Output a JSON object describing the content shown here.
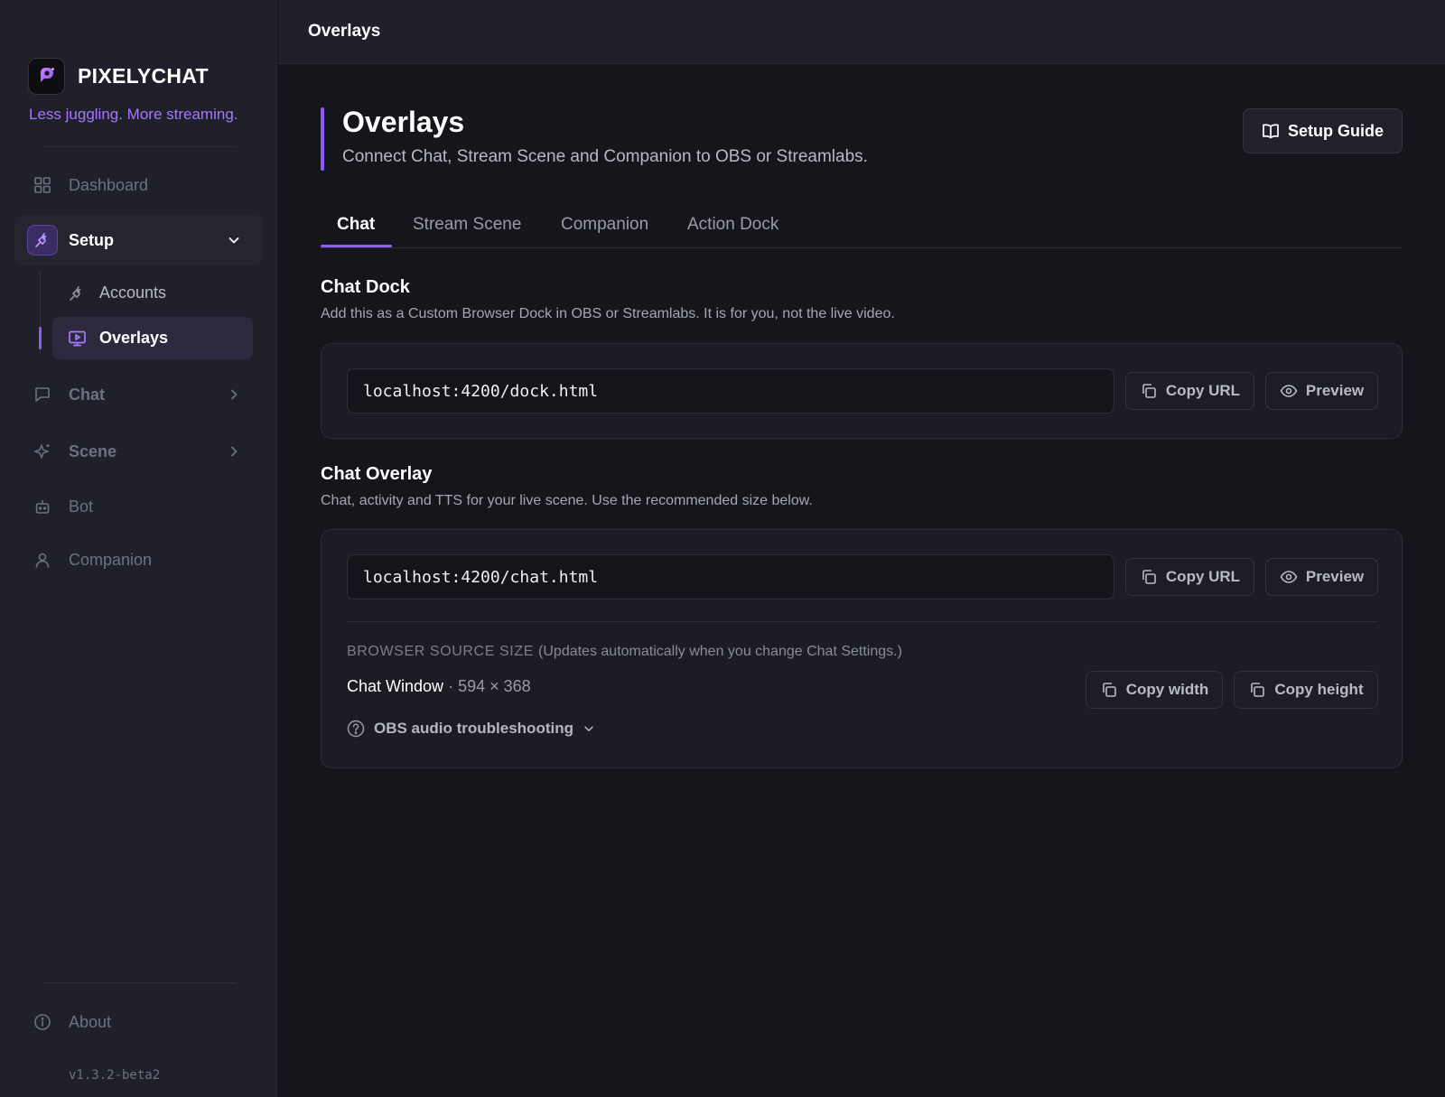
{
  "app": {
    "name": "PIXELYCHAT",
    "tagline": "Less juggling. More streaming.",
    "version": "v1.3.2-beta2"
  },
  "colors": {
    "accent": "#8b5cf6",
    "tagline": "#a178ff",
    "background": "#15161c",
    "sidebar": "#1f2029"
  },
  "sidebar": {
    "items": [
      {
        "label": "Dashboard",
        "icon": "grid-icon"
      },
      {
        "label": "Setup",
        "icon": "plug-icon",
        "expanded": true,
        "active": true
      },
      {
        "label": "Chat",
        "icon": "message-square-icon"
      },
      {
        "label": "Scene",
        "icon": "sparkles-icon"
      },
      {
        "label": "Bot",
        "icon": "bot-icon"
      },
      {
        "label": "Companion",
        "icon": "user-icon"
      }
    ],
    "setup_children": [
      {
        "label": "Accounts",
        "icon": "plug-icon"
      },
      {
        "label": "Overlays",
        "icon": "monitor-play-icon",
        "active": true
      }
    ],
    "footer": {
      "label": "About",
      "icon": "info-icon"
    }
  },
  "topbar": {
    "title": "Overlays"
  },
  "page": {
    "title": "Overlays",
    "subtitle": "Connect Chat, Stream Scene and Companion to OBS or Streamlabs.",
    "setup_guide_label": "Setup Guide"
  },
  "tabs": [
    {
      "label": "Chat",
      "active": true
    },
    {
      "label": "Stream Scene"
    },
    {
      "label": "Companion"
    },
    {
      "label": "Action Dock"
    }
  ],
  "chat_dock": {
    "title": "Chat Dock",
    "description": "Add this as a Custom Browser Dock in OBS or Streamlabs. It is for you, not the live video.",
    "url": "localhost:4200/dock.html",
    "copy_label": "Copy URL",
    "preview_label": "Preview"
  },
  "chat_overlay": {
    "title": "Chat Overlay",
    "description": "Chat, activity and TTS for your live scene. Use the recommended size below.",
    "url": "localhost:4200/chat.html",
    "copy_label": "Copy URL",
    "preview_label": "Preview",
    "size_label": "BROWSER SOURCE SIZE",
    "size_note": "(Updates automatically when you change Chat Settings.)",
    "window_name": "Chat Window",
    "separator": "·",
    "dimensions": "594 × 368",
    "copy_width_label": "Copy width",
    "copy_height_label": "Copy height",
    "troubleshooting_label": "OBS audio troubleshooting"
  }
}
